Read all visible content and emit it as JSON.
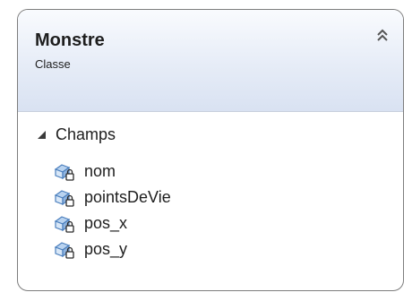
{
  "class": {
    "name": "Monstre",
    "stereotype": "Classe",
    "collapse_icon": "double-chevron-up-icon",
    "section": {
      "label": "Champs",
      "toggle_icon": "expanded-triangle-icon",
      "members": [
        {
          "label": "nom",
          "icon": "private-field-icon"
        },
        {
          "label": "pointsDeVie",
          "icon": "private-field-icon"
        },
        {
          "label": "pos_x",
          "icon": "private-field-icon"
        },
        {
          "label": "pos_y",
          "icon": "private-field-icon"
        }
      ]
    }
  },
  "colors": {
    "border": "#7d7d7d",
    "header_top": "#f9fbfe",
    "header_bottom": "#d9e2f2",
    "text": "#1e1e1e",
    "field_icon_blue": "#4b7fbd"
  }
}
